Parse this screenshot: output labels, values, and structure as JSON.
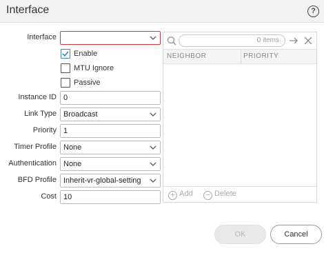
{
  "dialog": {
    "title": "Interface",
    "help_label": "?"
  },
  "form": {
    "interface_label": "Interface",
    "interface_value": "",
    "enable_label": "Enable",
    "enable_checked": true,
    "mtu_ignore_label": "MTU Ignore",
    "mtu_ignore_checked": false,
    "passive_label": "Passive",
    "passive_checked": false,
    "instance_id_label": "Instance ID",
    "instance_id_value": "0",
    "link_type_label": "Link Type",
    "link_type_value": "Broadcast",
    "priority_label": "Priority",
    "priority_value": "1",
    "timer_profile_label": "Timer Profile",
    "timer_profile_value": "None",
    "authentication_label": "Authentication",
    "authentication_value": "None",
    "bfd_profile_label": "BFD Profile",
    "bfd_profile_value": "Inherit-vr-global-setting",
    "cost_label": "Cost",
    "cost_value": "10"
  },
  "neighbor_panel": {
    "search_placeholder": "0 items",
    "columns": [
      "NEIGHBOR",
      "PRIORITY"
    ],
    "add_label": "Add",
    "delete_label": "Delete"
  },
  "buttons": {
    "ok_label": "OK",
    "cancel_label": "Cancel"
  },
  "colors": {
    "accent": "#3a7fc1",
    "error_border": "#d0343c"
  }
}
